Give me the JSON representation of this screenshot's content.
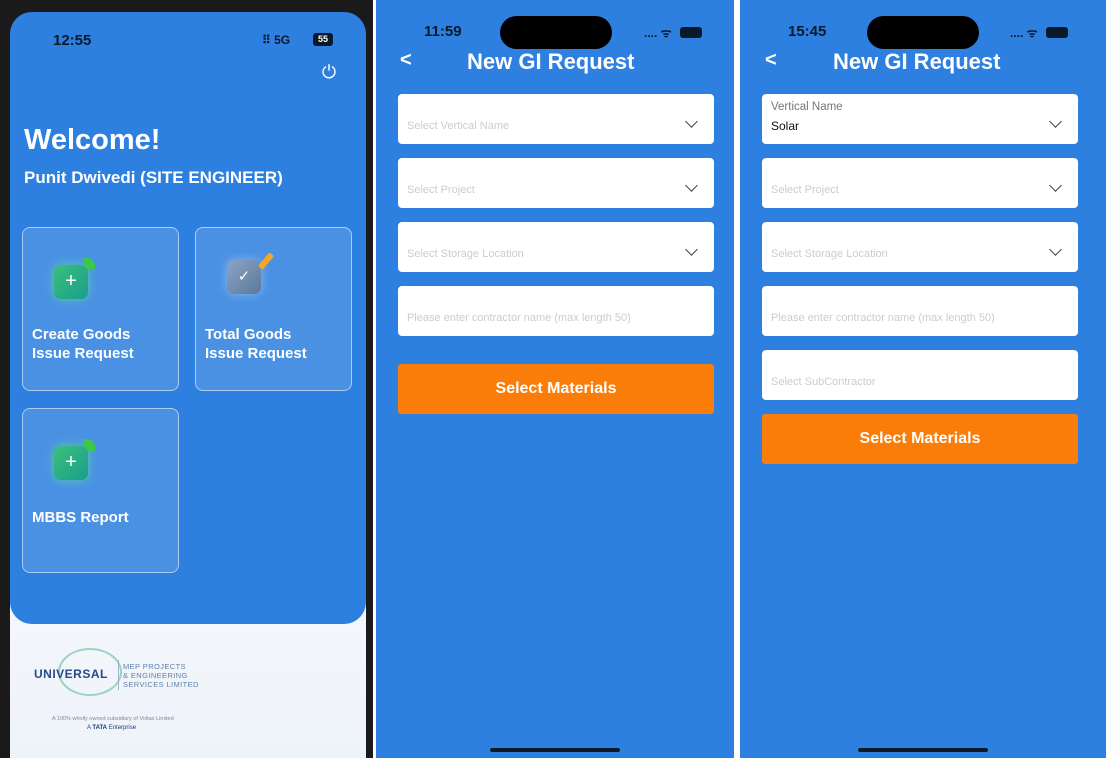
{
  "screen1": {
    "status": {
      "time": "12:55",
      "network": "5G",
      "battery": "55"
    },
    "welcome": "Welcome!",
    "user": "Punit Dwivedi (SITE ENGINEER)",
    "cards": [
      {
        "line1": "Create Goods",
        "line2": "Issue Request",
        "icon": "plus-icon"
      },
      {
        "line1": "Total Goods",
        "line2": "Issue Request",
        "icon": "checklist-icon"
      },
      {
        "line1": "MBBS Report",
        "line2": "",
        "icon": "plus-icon"
      }
    ],
    "logo": {
      "word": "UNIVERSAL",
      "sub1": "MEP PROJECTS",
      "sub2": "& ENGINEERING",
      "sub3": "SERVICES LIMITED"
    },
    "tagline": "A 100% wholly owned subsidiary of Voltas Limited",
    "tata_prefix": "A",
    "tata_brand": "TATA",
    "tata_suffix": "Enterprise"
  },
  "screen2": {
    "status": {
      "time": "11:59"
    },
    "back": "<",
    "title": "New GI Request",
    "fields": {
      "vertical": "Select Vertical Name",
      "project": "Select Project",
      "storage": "Select Storage Location",
      "contractor": "Please enter contractor name (max length 50)"
    },
    "button": "Select Materials"
  },
  "screen3": {
    "status": {
      "time": "15:45"
    },
    "back": "<",
    "title": "New GI Request",
    "fields": {
      "vertical_label": "Vertical Name",
      "vertical_value": "Solar",
      "project": "Select Project",
      "storage": "Select Storage Location",
      "contractor": "Please enter contractor name (max length 50)",
      "subcontractor": "Select SubContractor"
    },
    "button": "Select Materials"
  },
  "colors": {
    "primary": "#2d7fe0",
    "accent": "#fa7d0a"
  }
}
